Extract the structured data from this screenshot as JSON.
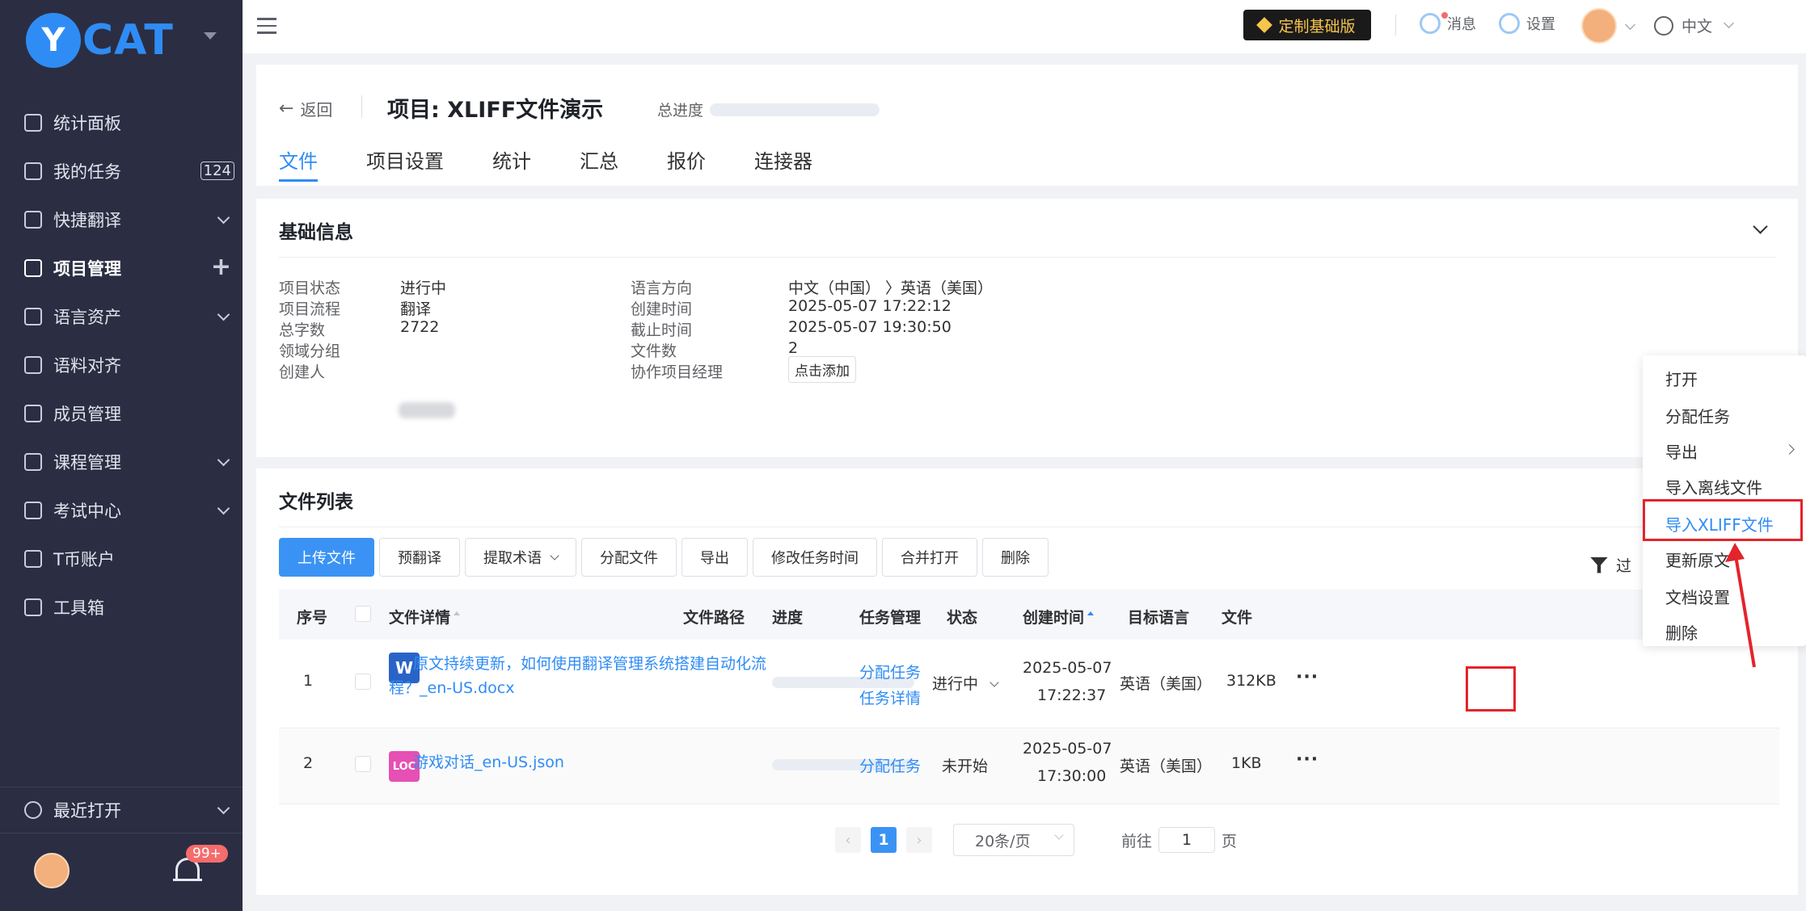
{
  "app": {
    "logo_badge": "Y",
    "logo_text": "CAT"
  },
  "sidebar": {
    "items": [
      {
        "label": "统计面板"
      },
      {
        "label": "我的任务",
        "badge": "124"
      },
      {
        "label": "快捷翻译"
      },
      {
        "label": "项目管理",
        "active": true
      },
      {
        "label": "语言资产"
      },
      {
        "label": "语料对齐"
      },
      {
        "label": "成员管理"
      },
      {
        "label": "课程管理"
      },
      {
        "label": "考试中心"
      },
      {
        "label": "T币账户"
      },
      {
        "label": "工具箱"
      }
    ],
    "recent_label": "最近打开",
    "notification_badge": "99+"
  },
  "header": {
    "vip_label": "定制基础版",
    "message_label": "消息",
    "settings_label": "设置",
    "language_label": "中文"
  },
  "project": {
    "back_label": "返回",
    "title": "项目: XLIFF文件演示",
    "progress_label": "总进度",
    "tabs": [
      "文件",
      "项目设置",
      "统计",
      "汇总",
      "报价",
      "连接器"
    ]
  },
  "basic_info": {
    "title": "基础信息",
    "left": [
      {
        "label": "项目状态",
        "value": "进行中"
      },
      {
        "label": "项目流程",
        "value": "翻译"
      },
      {
        "label": "总字数",
        "value": "2722"
      },
      {
        "label": "领域分组",
        "value": ""
      },
      {
        "label": "创建人",
        "value": ""
      }
    ],
    "right": [
      {
        "label": "语言方向",
        "value": "中文（中国） 〉英语（美国）"
      },
      {
        "label": "创建时间",
        "value": "2025-05-07 17:22:12"
      },
      {
        "label": "截止时间",
        "value": "2025-05-07 19:30:50"
      },
      {
        "label": "文件数",
        "value": "2"
      },
      {
        "label": "协作项目经理",
        "value": ""
      }
    ],
    "add_button": "点击添加"
  },
  "file_list": {
    "title": "文件列表",
    "toolbar": [
      "上传文件",
      "预翻译",
      "提取术语",
      "分配文件",
      "导出",
      "修改任务时间",
      "合并打开",
      "删除"
    ],
    "filter_label": "过",
    "columns": [
      "序号",
      "文件详情",
      "文件路径",
      "进度",
      "任务管理",
      "状态",
      "创建时间",
      "目标语言",
      "文件"
    ],
    "rows": [
      {
        "index": "1",
        "icon": "W",
        "name_line1": "原文持续更新，如何使用翻译管理系统搭建自动化流",
        "name_line2": "程？_en-US.docx",
        "task_link1": "分配任务",
        "task_link2": "任务详情",
        "status": "进行中",
        "date": "2025-05-07",
        "time": "17:22:37",
        "target": "英语（美国）",
        "size": "312KB"
      },
      {
        "index": "2",
        "icon": "LOC",
        "name_line1": "游戏对话_en-US.json",
        "task_link1": "分配任务",
        "status": "未开始",
        "date": "2025-05-07",
        "time": "17:30:00",
        "target": "英语（美国）",
        "size": "1KB"
      }
    ],
    "pagination": {
      "prev": "‹",
      "page": "1",
      "next": "›",
      "page_size": "20条/页",
      "goto_prefix": "前往",
      "goto_value": "1",
      "goto_suffix": "页"
    }
  },
  "context_menu": {
    "items": [
      "打开",
      "分配任务",
      "导出",
      "导入离线文件",
      "导入XLIFF文件",
      "更新原文",
      "文档设置",
      "删除"
    ]
  }
}
